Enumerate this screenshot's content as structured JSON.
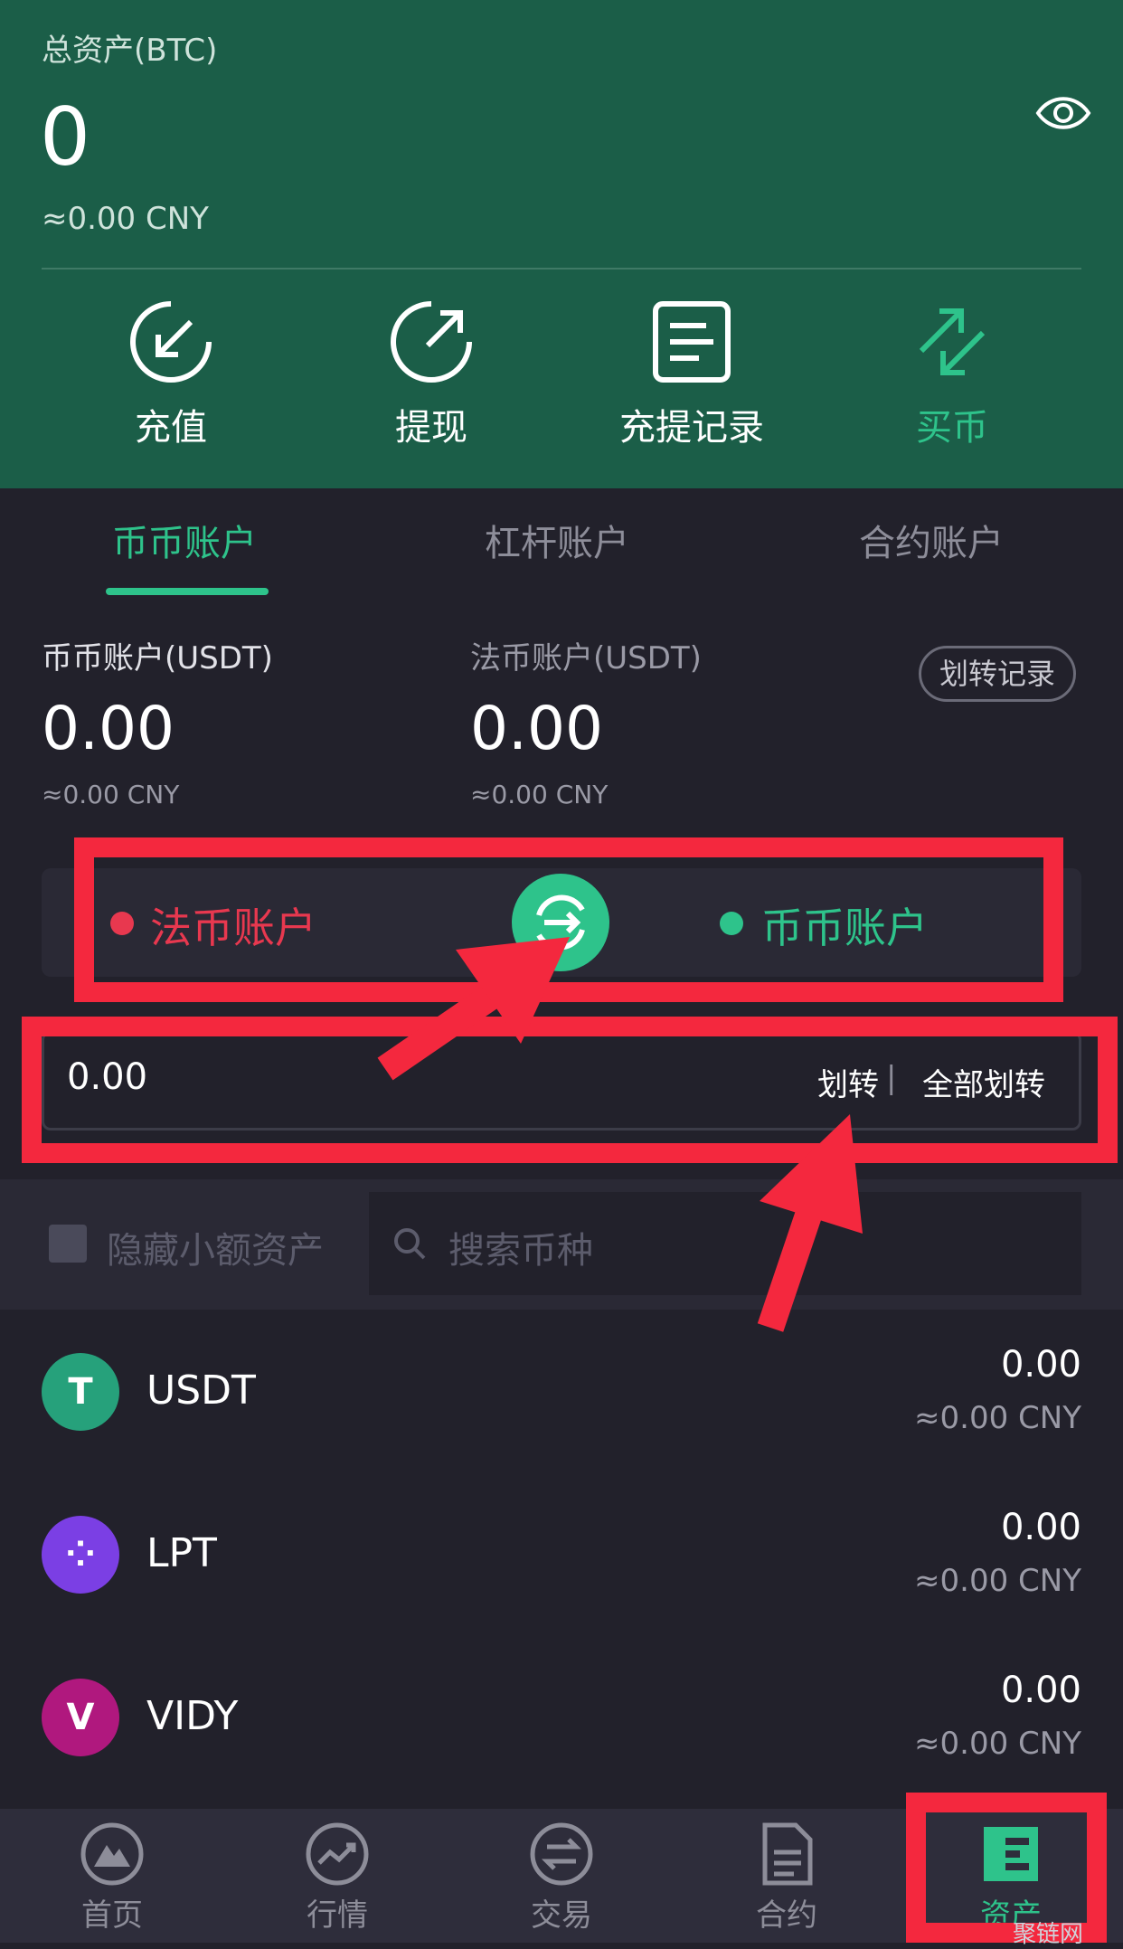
{
  "header": {
    "total_label": "总资产(BTC)",
    "total_value": "0",
    "total_cny": "≈0.00 CNY",
    "actions": [
      {
        "label": "充值",
        "icon": "deposit-icon"
      },
      {
        "label": "提现",
        "icon": "withdraw-icon"
      },
      {
        "label": "充提记录",
        "icon": "records-icon"
      },
      {
        "label": "买币",
        "icon": "buy-icon"
      }
    ]
  },
  "tabs": [
    "币币账户",
    "杠杆账户",
    "合约账户"
  ],
  "accounts": {
    "spot": {
      "title": "币币账户(USDT)",
      "value": "0.00",
      "cny": "≈0.00 CNY"
    },
    "fiat": {
      "title": "法币账户(USDT)",
      "value": "0.00",
      "cny": "≈0.00 CNY"
    },
    "transfer_records": "划转记录"
  },
  "transfer": {
    "from": "法币账户",
    "to": "币币账户",
    "amount": "0.00",
    "transfer_label": "划转",
    "separator": "|",
    "transfer_all_label": "全部划转"
  },
  "filter": {
    "hide_small": "隐藏小额资产",
    "search_placeholder": "搜索币种"
  },
  "assets": [
    {
      "name": "USDT",
      "value": "0.00",
      "cny": "≈0.00 CNY",
      "color": "#26a17b",
      "glyph": "T"
    },
    {
      "name": "LPT",
      "value": "0.00",
      "cny": "≈0.00 CNY",
      "color": "#7b3fe4",
      "glyph": "⁘"
    },
    {
      "name": "VIDY",
      "value": "0.00",
      "cny": "≈0.00 CNY",
      "color": "#b0187e",
      "glyph": "V"
    }
  ],
  "nav": [
    {
      "label": "首页"
    },
    {
      "label": "行情"
    },
    {
      "label": "交易"
    },
    {
      "label": "合约"
    },
    {
      "label": "资产"
    }
  ],
  "watermark": "聚链网",
  "colors": {
    "header_bg": "#1b5e48",
    "accent": "#2ec38b",
    "fiat_red": "#e8384f",
    "annotation_red": "#f4283e"
  }
}
